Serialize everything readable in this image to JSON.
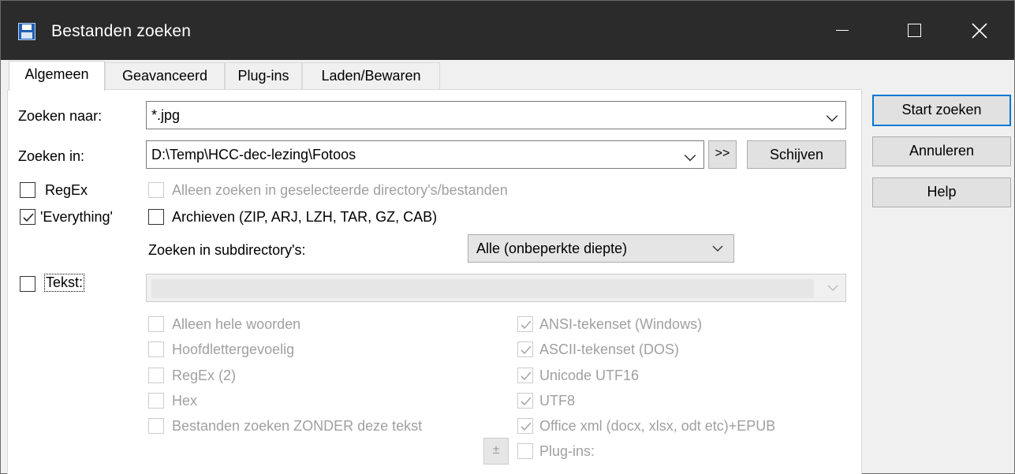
{
  "window": {
    "title": "Bestanden zoeken",
    "colors": {
      "titlebar": "#2b2b2b",
      "accent": "#0078d7",
      "panel": "#ffffff"
    }
  },
  "tabs": [
    {
      "label": "Algemeen",
      "active": true
    },
    {
      "label": "Geavanceerd",
      "active": false
    },
    {
      "label": "Plug-ins",
      "active": false
    },
    {
      "label": "Laden/Bewaren",
      "active": false
    }
  ],
  "search_for": {
    "label": "Zoeken naar:",
    "value": "*.jpg"
  },
  "search_in": {
    "label": "Zoeken in:",
    "value": "D:\\Temp\\HCC-dec-lezing\\Fotoos",
    "browse_label": ">>",
    "drives_label": "Schijven"
  },
  "options": {
    "regex_label": "RegEx",
    "regex_checked": false,
    "everything_label": "'Everything'",
    "everything_checked": true,
    "selected_only_label": "Alleen zoeken in geselecteerde directory's/bestanden",
    "archives_label": "Archieven (ZIP, ARJ, LZH, TAR, GZ, CAB)",
    "subdirs_label": "Zoeken in subdirectory's:",
    "subdirs_value": "Alle (onbeperkte diepte)"
  },
  "text_search": {
    "label": "Tekst:",
    "checked": false,
    "value": "",
    "left_options": [
      {
        "label": "Alleen hele woorden",
        "checked": false
      },
      {
        "label": "Hoofdlettergevoelig",
        "checked": false
      },
      {
        "label": "RegEx (2)",
        "checked": false
      },
      {
        "label": "Hex",
        "checked": false
      },
      {
        "label": "Bestanden zoeken ZONDER deze tekst",
        "checked": false
      }
    ],
    "right_options": [
      {
        "label": "ANSI-tekenset (Windows)",
        "checked": true
      },
      {
        "label": "ASCII-tekenset (DOS)",
        "checked": true
      },
      {
        "label": "Unicode UTF16",
        "checked": true
      },
      {
        "label": "UTF8",
        "checked": true
      },
      {
        "label": "Office xml (docx, xlsx, odt etc)+EPUB",
        "checked": true
      },
      {
        "label": "Plug-ins:",
        "checked": false
      }
    ],
    "plus_label": "±"
  },
  "actions": {
    "start_label": "Start zoeken",
    "cancel_label": "Annuleren",
    "help_label": "Help"
  },
  "icons": [
    "app-floppy-icon",
    "minimize-icon",
    "maximize-icon",
    "close-icon",
    "chevron-down-icon",
    "checkmark-icon"
  ]
}
